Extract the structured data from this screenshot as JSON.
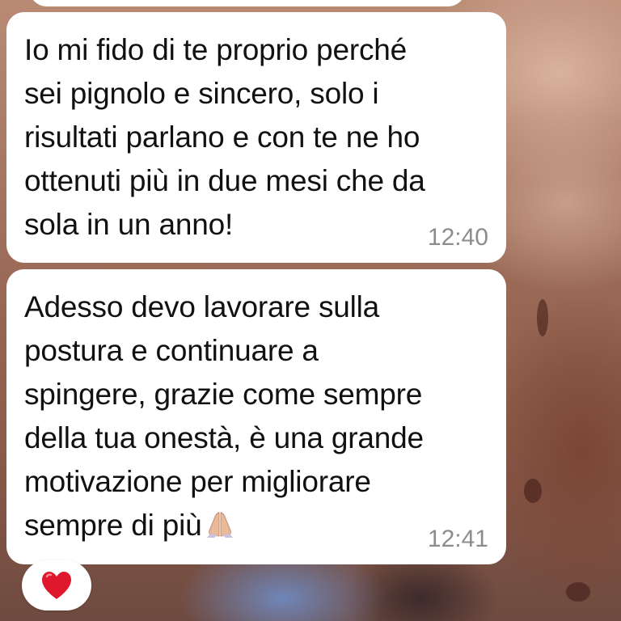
{
  "messages": [
    {
      "text": "Io mi fido di te proprio perché\nsei pignolo e sincero, solo i\nrisultati parlano e con te ne ho\nottenuti più in due mesi che da\nsola in un anno!",
      "time": "12:40"
    },
    {
      "text": "Adesso devo lavorare sulla\npostura e continuare a\nspingere, grazie come sempre\ndella tua onestà, è una grande\nmotivazione per migliorare\nsempre di più",
      "emoji": "folded-hands-emoji",
      "time": "12:41",
      "reaction": "red-heart-emoji"
    }
  ],
  "colors": {
    "bubble": "#ffffff",
    "text": "#111111",
    "timestamp": "#8c8c8c",
    "heart": "#e0182d"
  }
}
